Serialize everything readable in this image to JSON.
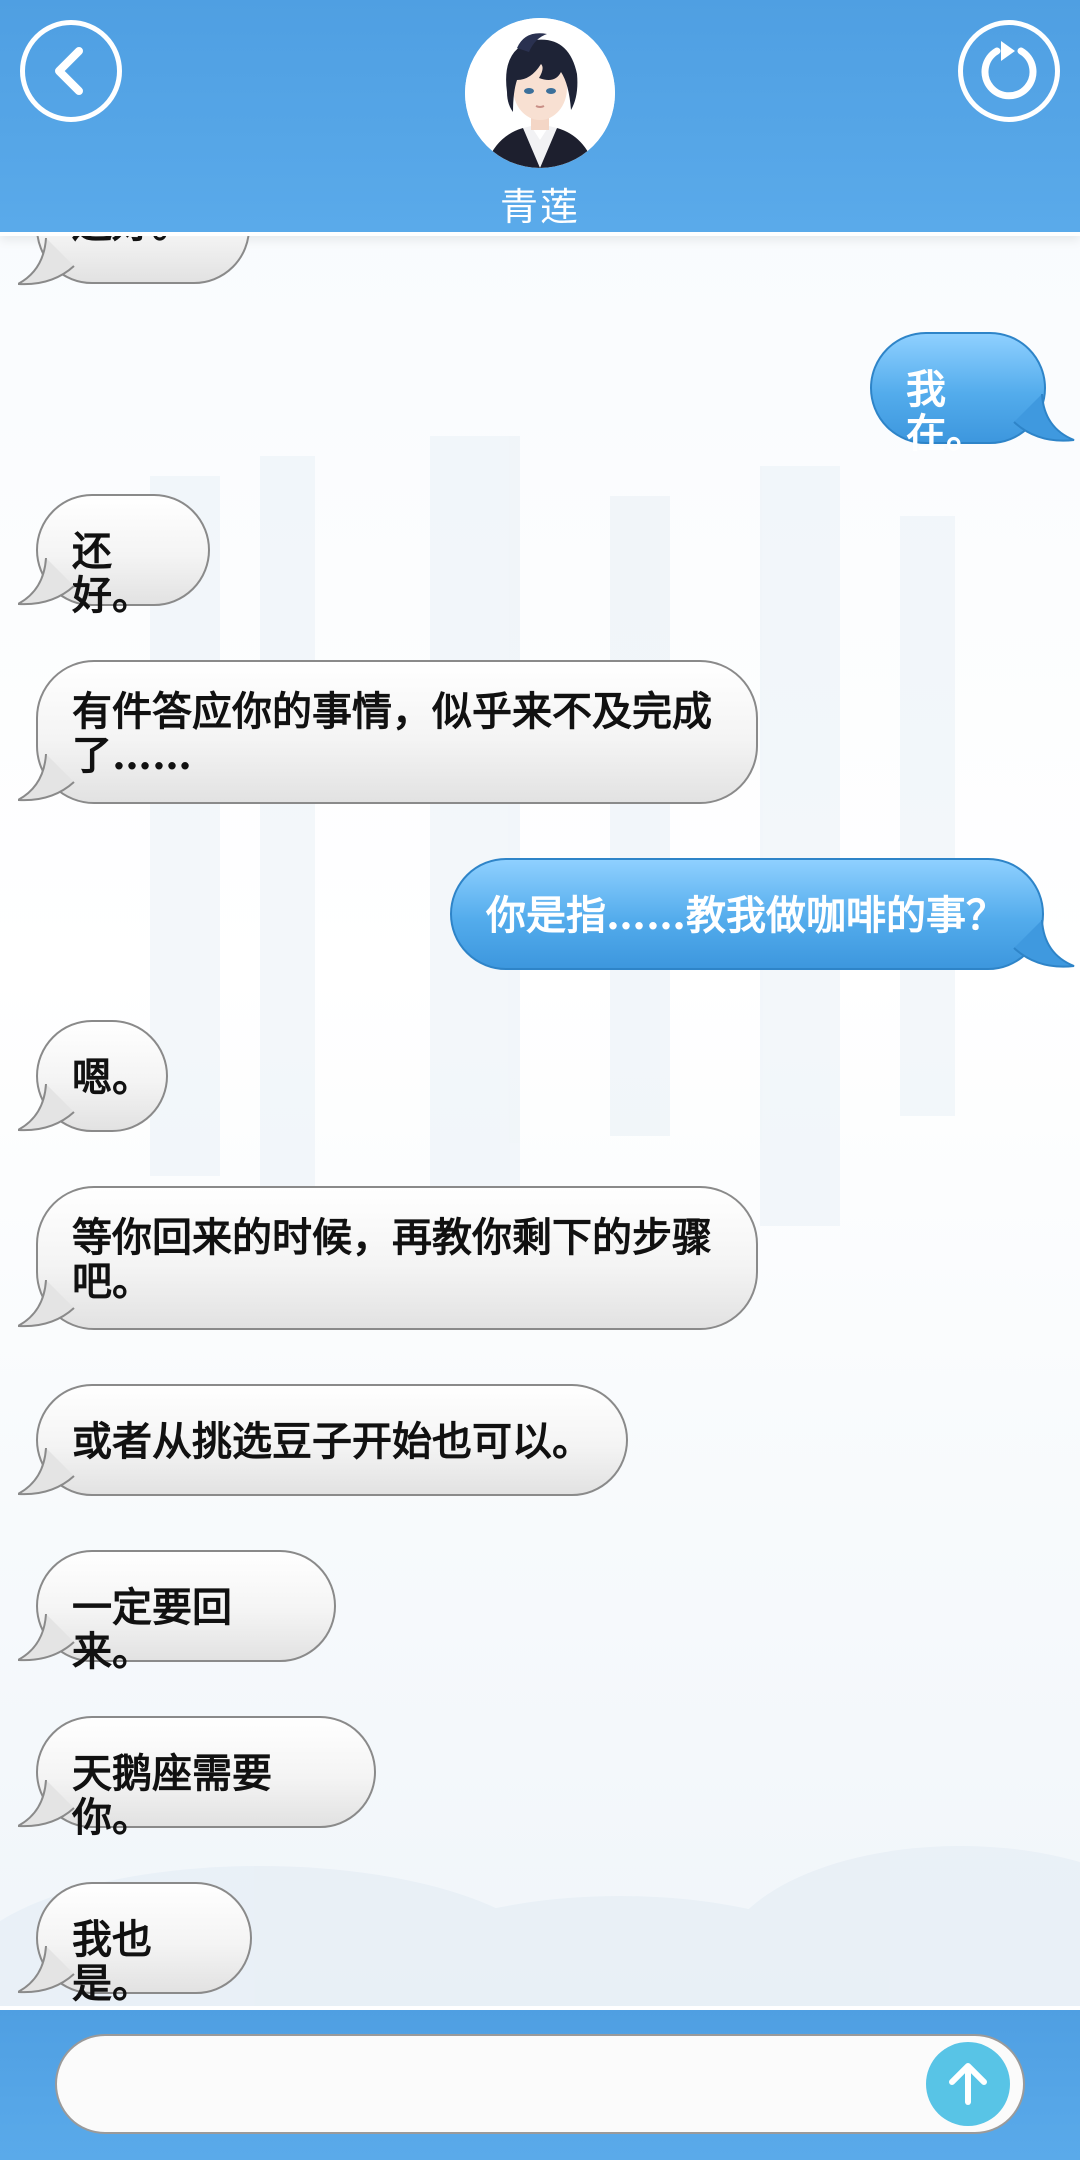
{
  "header": {
    "contact_name": "青莲",
    "back_icon": "back-arrow-icon",
    "refresh_icon": "refresh-icon",
    "accent_color": "#4f9fe2"
  },
  "messages": [
    {
      "side": "in",
      "text": "还好。"
    },
    {
      "side": "out",
      "text": "我在。"
    },
    {
      "side": "in",
      "text": "还好。"
    },
    {
      "side": "in",
      "text": "有件答应你的事情，似乎来不及完成了……"
    },
    {
      "side": "out",
      "text": "你是指……教我做咖啡的事？"
    },
    {
      "side": "in",
      "text": "嗯。"
    },
    {
      "side": "in",
      "text": "等你回来的时候，再教你剩下的步骤吧。"
    },
    {
      "side": "in",
      "text": "或者从挑选豆子开始也可以。"
    },
    {
      "side": "in",
      "text": "一定要回来。"
    },
    {
      "side": "in",
      "text": "天鹅座需要你。"
    },
    {
      "side": "in",
      "text": "我也是。"
    }
  ],
  "composer": {
    "value": "",
    "send_icon": "arrow-up-icon"
  }
}
